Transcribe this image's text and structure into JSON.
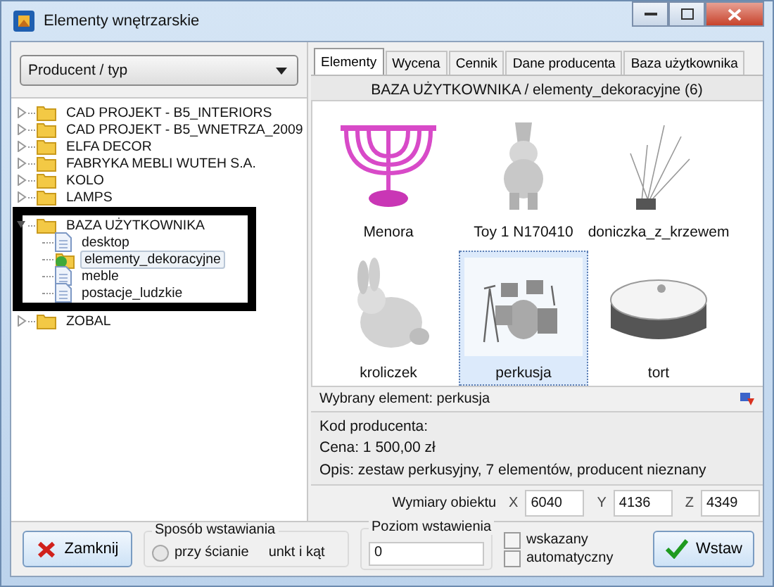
{
  "window": {
    "title": "Elementy wnętrzarskie"
  },
  "filter": {
    "value": "Producent / typ"
  },
  "tree": [
    {
      "label": "CAD PROJEKT - B5_INTERIORS",
      "kind": "folder",
      "expanded": false,
      "selected": false
    },
    {
      "label": "CAD PROJEKT - B5_WNETRZA_2009",
      "kind": "folder",
      "expanded": false,
      "selected": false
    },
    {
      "label": "ELFA DECOR",
      "kind": "folder",
      "expanded": false,
      "selected": false
    },
    {
      "label": "FABRYKA MEBLI WUTEH S.A.",
      "kind": "folder",
      "expanded": false,
      "selected": false
    },
    {
      "label": "KOLO",
      "kind": "folder",
      "expanded": false,
      "selected": false
    },
    {
      "label": "LAMPS",
      "kind": "folder",
      "expanded": false,
      "selected": false
    },
    {
      "label": "BAZA UŻYTKOWNIKA",
      "kind": "folder",
      "expanded": true,
      "selected": false,
      "children": [
        {
          "label": "desktop",
          "kind": "document",
          "selected": false
        },
        {
          "label": "elementy_dekoracyjne",
          "kind": "special",
          "selected": true
        },
        {
          "label": "meble",
          "kind": "document",
          "selected": false
        },
        {
          "label": "postacje_ludzkie",
          "kind": "document",
          "selected": false
        }
      ]
    },
    {
      "label": "ZOBAL",
      "kind": "folder",
      "expanded": false,
      "selected": false
    }
  ],
  "tabs": [
    {
      "label": "Elementy",
      "selected": true
    },
    {
      "label": "Wycena",
      "selected": false
    },
    {
      "label": "Cennik",
      "selected": false
    },
    {
      "label": "Dane producenta",
      "selected": false
    },
    {
      "label": "Baza użytkownika",
      "selected": false
    }
  ],
  "breadcrumb": "BAZA UŻYTKOWNIKA / elementy_dekoracyjne (6)",
  "items": [
    {
      "label": "Menora",
      "selected": false
    },
    {
      "label": "Toy 1 N170410",
      "selected": false
    },
    {
      "label": "doniczka_z_krzewem",
      "selected": false
    },
    {
      "label": "kroliczek",
      "selected": false
    },
    {
      "label": "perkusja",
      "selected": true
    },
    {
      "label": "tort",
      "selected": false
    }
  ],
  "selected_element": "Wybrany element: perkusja",
  "details": [
    "Kod producenta:",
    "Cena: 1 500,00 zł",
    "Opis: zestaw perkusyjny, 7 elementów, producent nieznany"
  ],
  "dimensions": {
    "label": "Wymiary obiektu",
    "fields": [
      {
        "axis": "X",
        "value": "6040"
      },
      {
        "axis": "Y",
        "value": "4136"
      },
      {
        "axis": "Z",
        "value": "4349"
      }
    ]
  },
  "close_button": "Zamknij",
  "insert_mode": {
    "title": "Sposób wstawiania",
    "option": {
      "label": "przy ścianie",
      "selected": false
    },
    "partial_option": "unkt i kąt"
  },
  "insert_level": {
    "title": "Poziom wstawienia",
    "value": "0"
  },
  "level_options": [
    {
      "label": "wskazany",
      "checked": false
    },
    {
      "label": "automatyczny",
      "checked": false
    }
  ],
  "insert_button": "Wstaw"
}
